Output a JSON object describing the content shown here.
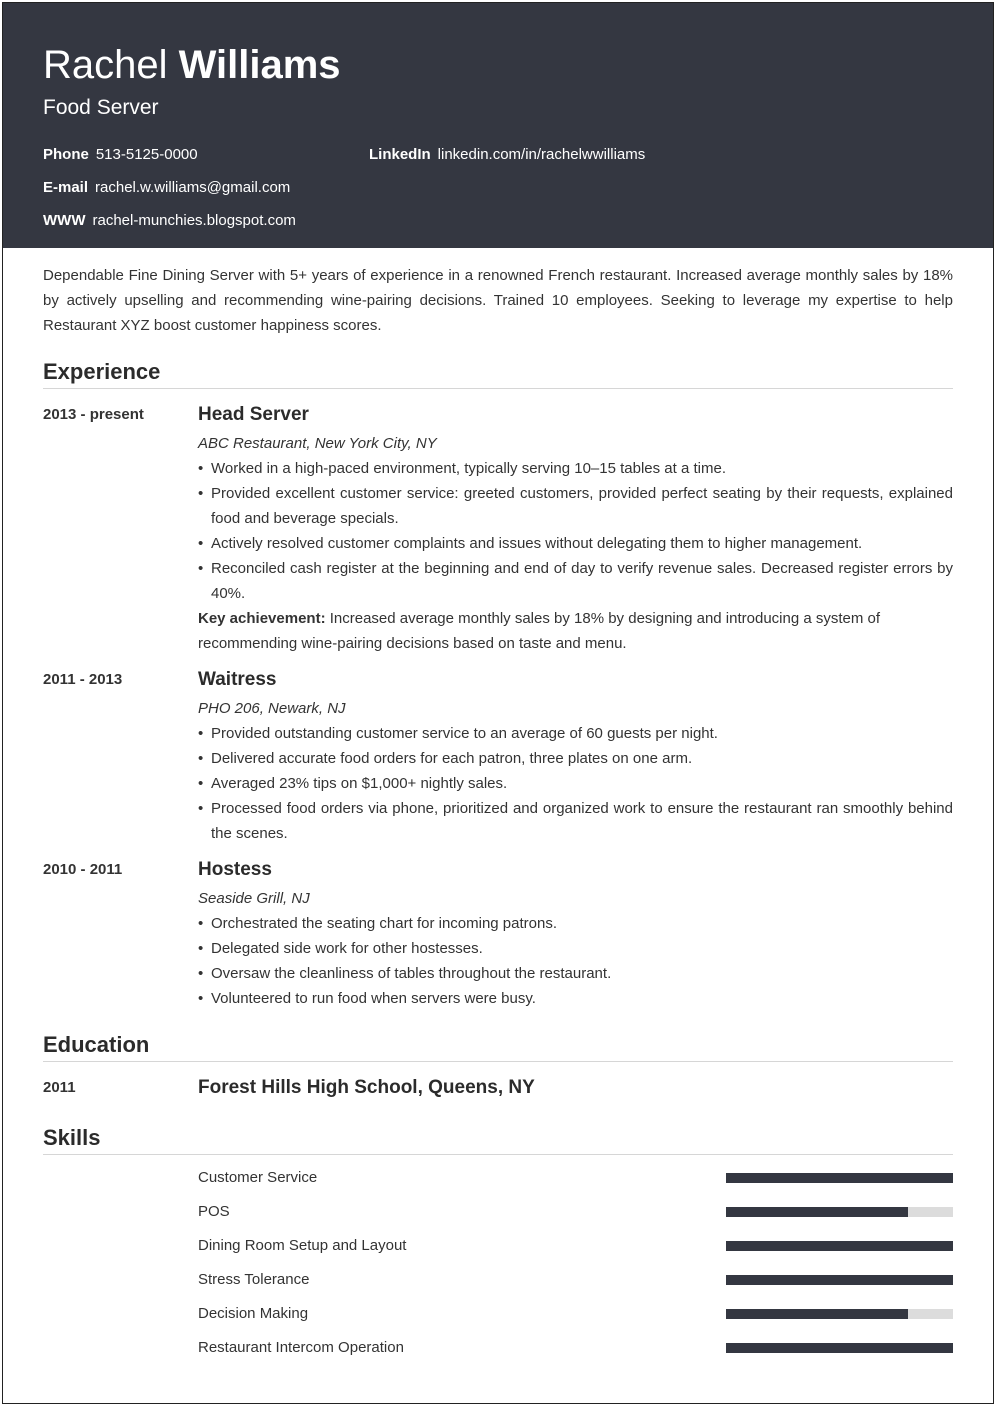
{
  "header": {
    "first_name": "Rachel",
    "last_name": "Williams",
    "title": "Food Server",
    "contacts": [
      {
        "label": "Phone",
        "value": "513-5125-0000"
      },
      {
        "label": "LinkedIn",
        "value": "linkedin.com/in/rachelwwilliams"
      },
      {
        "label": "E-mail",
        "value": "rachel.w.williams@gmail.com"
      },
      {
        "label": "WWW",
        "value": "rachel-munchies.blogspot.com"
      }
    ]
  },
  "summary": "Dependable Fine Dining Server with 5+ years of experience in a renowned French restaurant. Increased average monthly sales by 18% by actively upselling and recommending wine-pairing decisions. Trained 10 employees. Seeking to leverage my expertise to help Restaurant XYZ boost customer happiness scores.",
  "experience": {
    "heading": "Experience",
    "jobs": [
      {
        "dates": "2013 - present",
        "role": "Head Server",
        "company": "ABC Restaurant, New York City, NY",
        "bullets": [
          "Worked in a high-paced environment, typically serving 10–15 tables at a time.",
          "Provided excellent customer service: greeted customers, provided perfect seating by their requests, explained food and beverage specials.",
          "Actively resolved customer complaints and issues without delegating them to higher management.",
          "Reconciled cash register at the beginning and end of day to verify revenue sales. Decreased register errors by 40%."
        ],
        "achievement_label": "Key achievement:",
        "achievement_text": " Increased average monthly sales by 18% by designing and introducing a system of recommending wine-pairing decisions based on taste and menu."
      },
      {
        "dates": "2011 - 2013",
        "role": "Waitress",
        "company": "PHO 206, Newark, NJ",
        "bullets": [
          "Provided outstanding customer service to an average of 60 guests per night.",
          "Delivered accurate food orders for each patron, three plates on one arm.",
          "Averaged 23% tips on $1,000+ nightly sales.",
          "Processed food orders via phone, prioritized and organized work to ensure the restaurant ran smoothly behind the scenes."
        ]
      },
      {
        "dates": "2010 - 2011",
        "role": "Hostess",
        "company": "Seaside Grill, NJ",
        "bullets": [
          "Orchestrated the seating chart for incoming patrons.",
          "Delegated side work for other hostesses.",
          "Oversaw the cleanliness of tables throughout the restaurant.",
          "Volunteered to run food when servers were busy."
        ]
      }
    ]
  },
  "education": {
    "heading": "Education",
    "entries": [
      {
        "year": "2011",
        "school": "Forest Hills High School, Queens, NY"
      }
    ]
  },
  "skills": {
    "heading": "Skills",
    "items": [
      {
        "name": "Customer Service",
        "level": 1.0
      },
      {
        "name": "POS",
        "level": 0.8
      },
      {
        "name": "Dining Room Setup and Layout",
        "level": 1.0
      },
      {
        "name": "Stress Tolerance",
        "level": 1.0
      },
      {
        "name": "Decision Making",
        "level": 0.8
      },
      {
        "name": "Restaurant Intercom Operation",
        "level": 1.0
      }
    ]
  },
  "colors": {
    "header_bg": "#343741",
    "bar_fill": "#343741",
    "bar_track": "#dcdcdc"
  }
}
